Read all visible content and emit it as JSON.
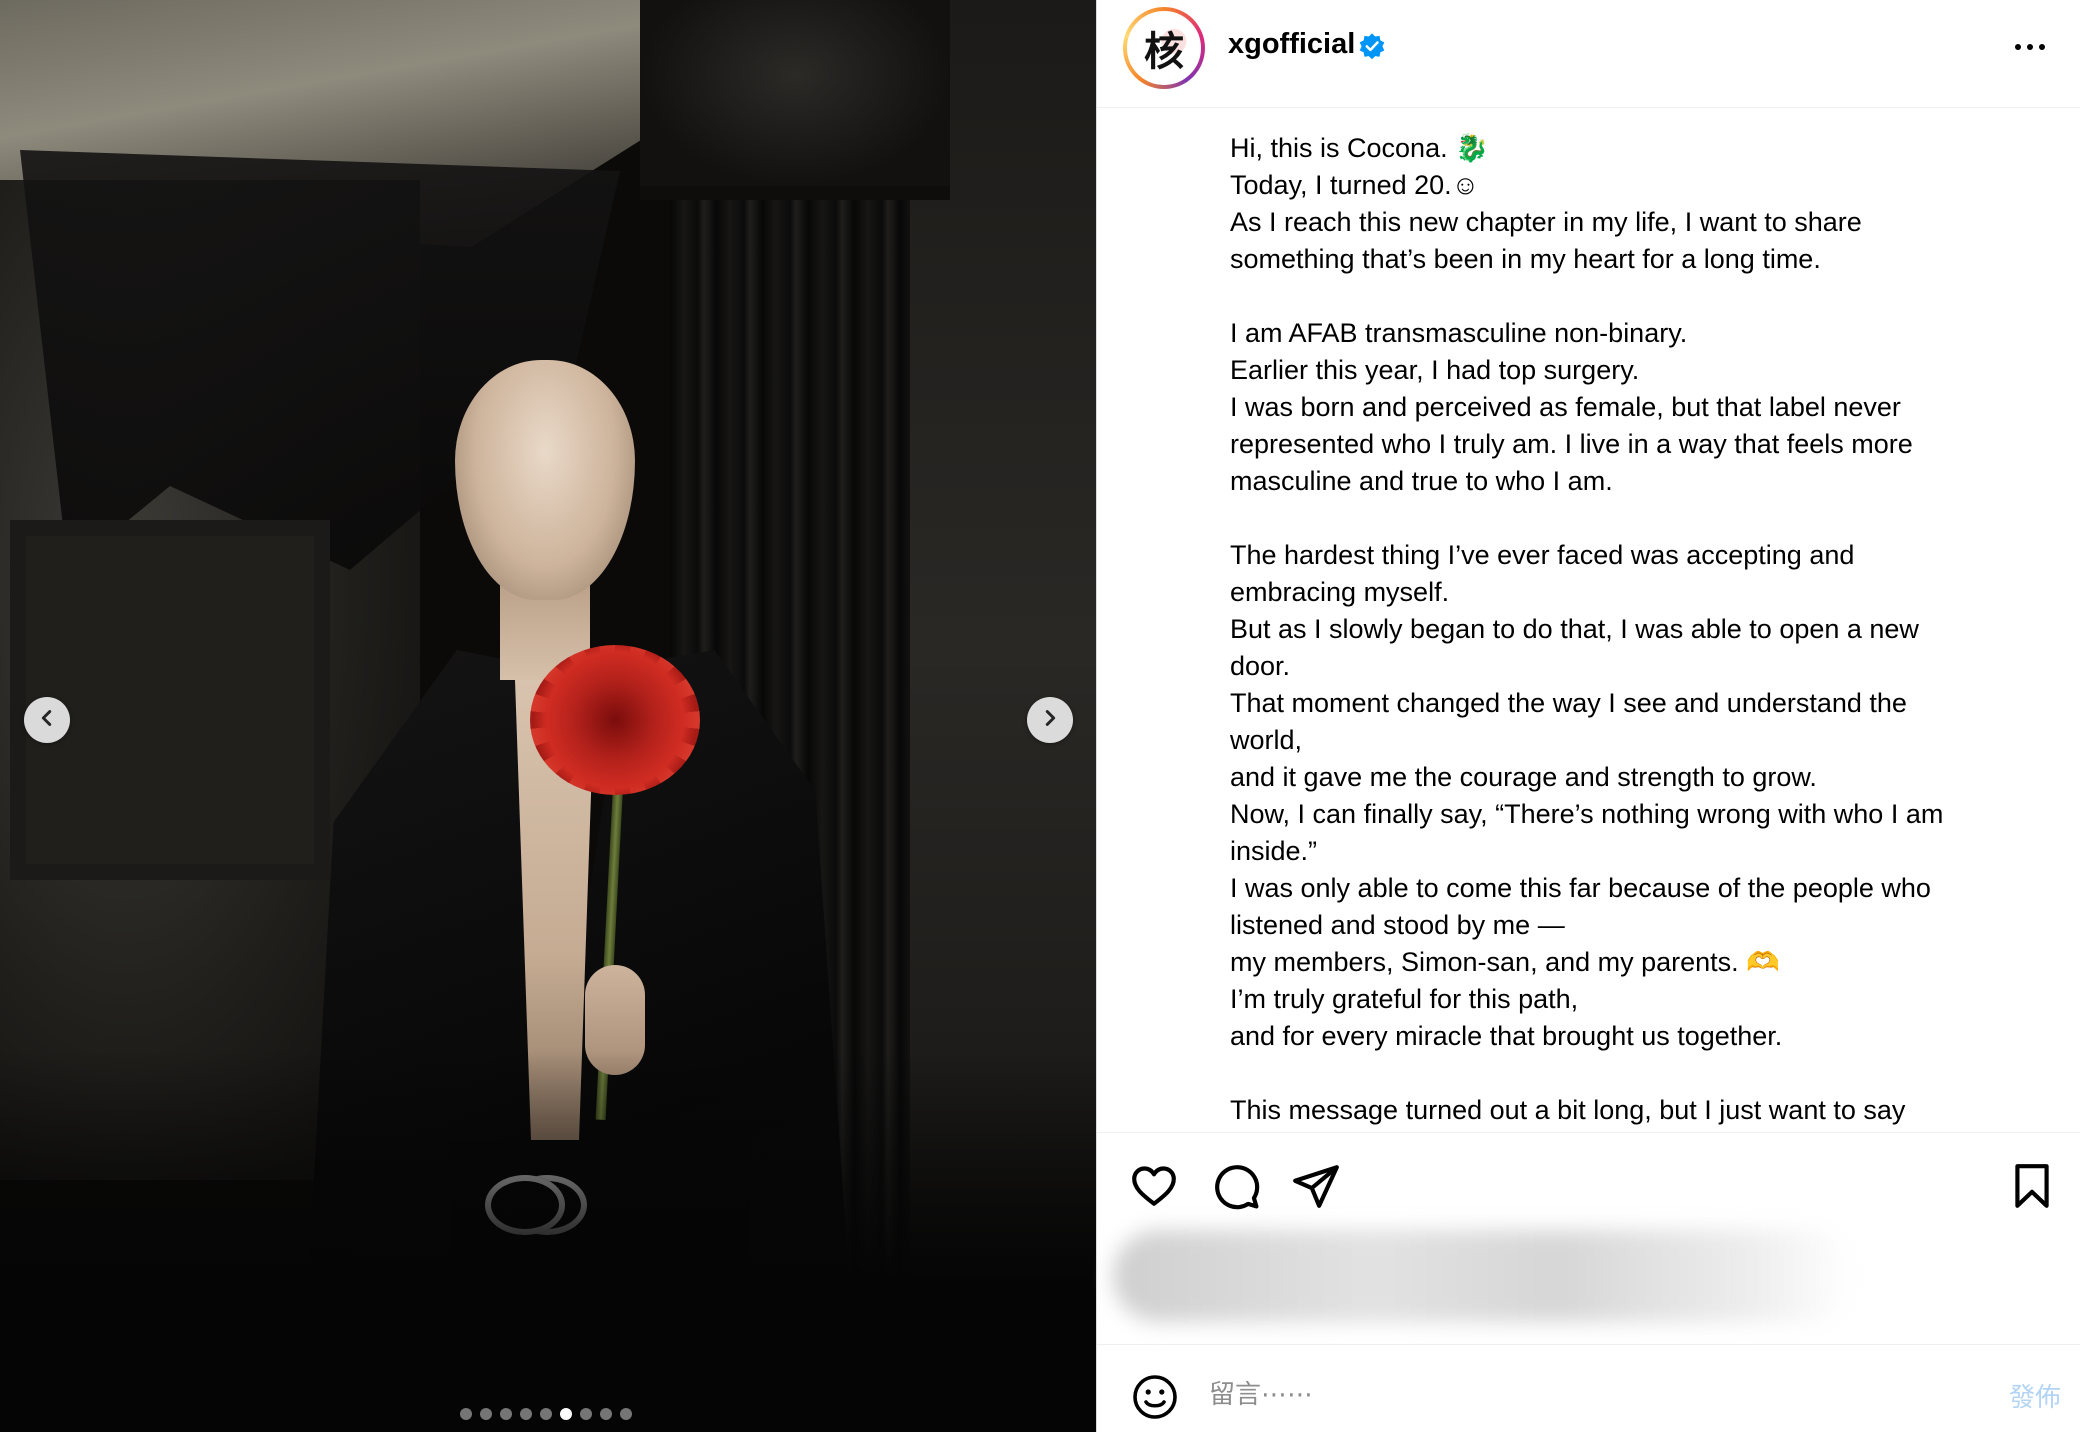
{
  "post": {
    "username": "xgofficial",
    "avatar_glyph": "核",
    "caption_lines": [
      "Hi, this is Cocona. 🐉",
      "Today, I turned 20.☺",
      "As I reach this new chapter in my life, I want to share",
      "something that’s been in my heart for a long time.",
      "",
      "I am AFAB transmasculine non-binary.",
      "Earlier this year, I had top surgery.",
      "I was born and perceived as female, but that label never",
      "represented who I truly am. I live in a way that feels more",
      "masculine and true to who I am.",
      "",
      "The hardest thing I’ve ever faced was accepting and",
      "embracing myself.",
      "But as I slowly began to do that, I was able to open a new",
      "door.",
      "That moment changed the way I see and understand the",
      "world,",
      "and it gave me the courage and strength to grow.",
      "Now, I can finally say, “There’s nothing wrong with who I am",
      "inside.”",
      "I was only able to come this far because of the people who",
      "listened and stood by me —",
      "my members, Simon-san, and my parents. 🫶",
      "I’m truly grateful for this path,",
      "and for every miracle that brought us together.",
      "",
      "This message turned out a bit long, but I just want to say"
    ]
  },
  "carousel": {
    "slide_count": 9,
    "active_index": 5
  },
  "comment": {
    "placeholder": "留言⋯⋯",
    "post_label": "發佈"
  },
  "icons": {
    "prev": "chevron-left-icon",
    "next": "chevron-right-icon",
    "verified": "verified-badge-icon",
    "more": "more-options-icon",
    "like": "heart-icon",
    "comment": "comment-icon",
    "share": "send-icon",
    "save": "bookmark-icon",
    "emoji": "emoji-icon"
  },
  "colors": {
    "verified_blue": "#0095f6",
    "post_button_disabled": "#b3d4f5",
    "divider": "#efefef"
  }
}
